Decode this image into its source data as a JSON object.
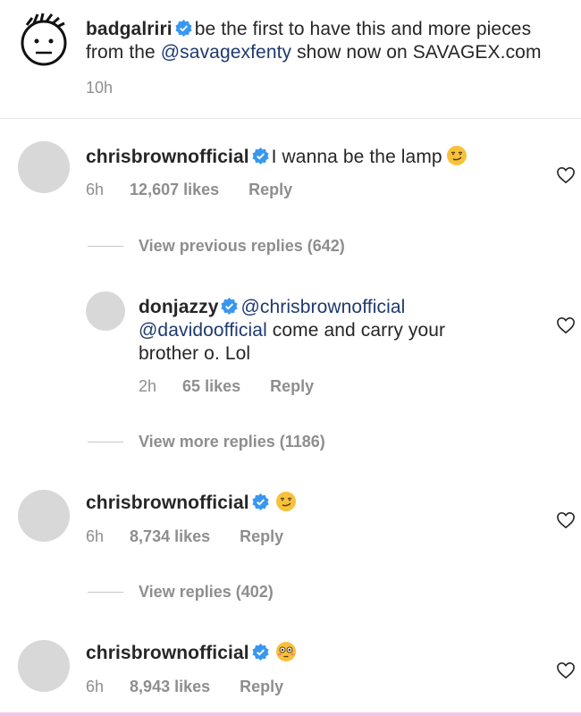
{
  "caption": {
    "username": "badgalriri",
    "text_line1": "be the first to have this and more pieces",
    "text_from": "from the",
    "mention": "@savagexfenty",
    "text_end": "show now on SAVAGEX.com",
    "time": "10h"
  },
  "comments": [
    {
      "username": "chrisbrownofficial",
      "text": "I wanna be the lamp",
      "emoji": "smirk-emoji",
      "time": "6h",
      "likes": "12,607 likes",
      "reply": "Reply",
      "view_replies": "View previous replies (642)"
    },
    {
      "username": "chrisbrownofficial",
      "text": "",
      "emoji": "smirk-emoji",
      "time": "6h",
      "likes": "8,734 likes",
      "reply": "Reply",
      "view_replies": "View replies (402)"
    },
    {
      "username": "chrisbrownofficial",
      "text": "",
      "emoji": "flushed-emoji",
      "time": "6h",
      "likes": "8,943 likes",
      "reply": "Reply"
    }
  ],
  "reply": {
    "username": "donjazzy",
    "mention1": "@chrisbrownofficial",
    "mention2": "@davidoofficial",
    "text_after": "come and carry your",
    "text_line3": "brother o. Lol",
    "time": "2h",
    "likes": "65 likes",
    "reply": "Reply",
    "view_more": "View more replies (1186)"
  },
  "colors": {
    "verified": "#3897f0",
    "mention": "#1f3a6e",
    "meta": "#8e8e8e"
  }
}
